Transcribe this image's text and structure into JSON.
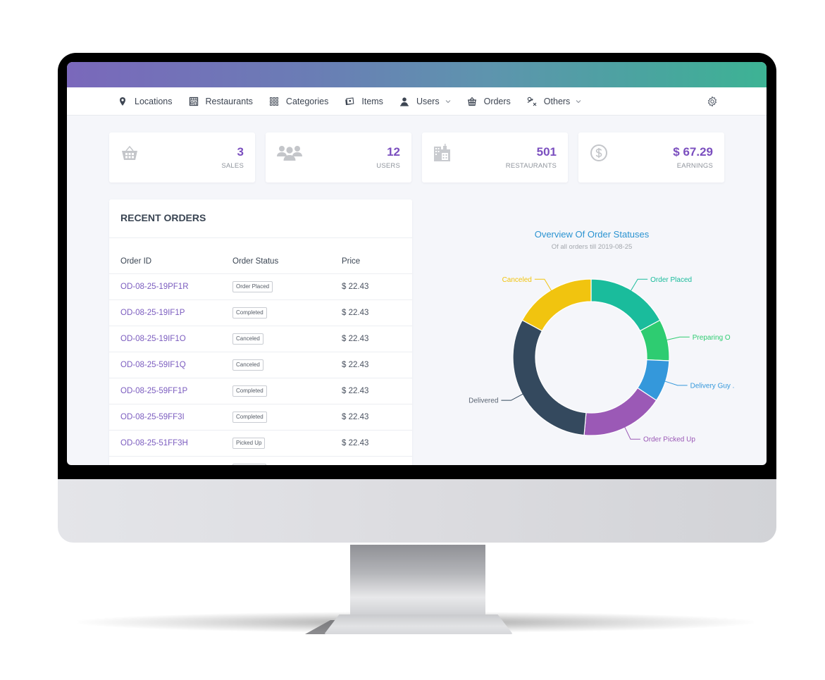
{
  "nav": {
    "items": [
      {
        "label": "Locations",
        "icon": "map-pin-icon",
        "dropdown": false
      },
      {
        "label": "Restaurants",
        "icon": "store-icon",
        "dropdown": false
      },
      {
        "label": "Categories",
        "icon": "grid-icon",
        "dropdown": false
      },
      {
        "label": "Items",
        "icon": "image-card-icon",
        "dropdown": false
      },
      {
        "label": "Users",
        "icon": "user-icon",
        "dropdown": true
      },
      {
        "label": "Orders",
        "icon": "basket-icon",
        "dropdown": false
      },
      {
        "label": "Others",
        "icon": "misc-icon",
        "dropdown": true
      }
    ],
    "settings_icon": "gear-icon"
  },
  "stats": [
    {
      "value": "3",
      "label": "SALES",
      "icon": "basket-icon"
    },
    {
      "value": "12",
      "label": "USERS",
      "icon": "users-group-icon"
    },
    {
      "value": "501",
      "label": "RESTAURANTS",
      "icon": "building-icon"
    },
    {
      "value": "$ 67.29",
      "label": "EARNINGS",
      "icon": "dollar-circle-icon"
    }
  ],
  "recent_orders": {
    "title": "RECENT ORDERS",
    "columns": [
      "Order ID",
      "Order Status",
      "Price"
    ],
    "rows": [
      {
        "id": "OD-08-25-19PF1R",
        "status": "Order Placed",
        "price": "$ 22.43"
      },
      {
        "id": "OD-08-25-19IF1P",
        "status": "Completed",
        "price": "$ 22.43"
      },
      {
        "id": "OD-08-25-19IF1O",
        "status": "Canceled",
        "price": "$ 22.43"
      },
      {
        "id": "OD-08-25-59IF1Q",
        "status": "Canceled",
        "price": "$ 22.43"
      },
      {
        "id": "OD-08-25-59FF1P",
        "status": "Completed",
        "price": "$ 22.43"
      },
      {
        "id": "OD-08-25-59FF3I",
        "status": "Completed",
        "price": "$ 22.43"
      },
      {
        "id": "OD-08-25-51FF3H",
        "status": "Picked Up",
        "price": "$ 22.43"
      },
      {
        "id": "",
        "status": "",
        "price": ""
      }
    ]
  },
  "chart_data": {
    "type": "pie",
    "variant": "donut",
    "title": "Overview Of Order Statuses",
    "subtitle": "Of all orders till 2019-08-25",
    "legend": "none (leader-line labels)",
    "slices": [
      {
        "label": "Order Placed",
        "display_label": "Order Placed",
        "value": 6,
        "color": "#1abc9c"
      },
      {
        "label": "Preparing Order",
        "display_label": "Preparing O",
        "value": 3,
        "color": "#2ecc71"
      },
      {
        "label": "Delivery Guy Assigned",
        "display_label": "Delivery Guy .",
        "value": 3,
        "color": "#3498db"
      },
      {
        "label": "Order Picked Up",
        "display_label": "Order Picked Up",
        "value": 6,
        "color": "#9b59b6"
      },
      {
        "label": "Delivered",
        "display_label": "Delivered",
        "value": 11,
        "color": "#34495e"
      },
      {
        "label": "Canceled",
        "display_label": "Canceled",
        "value": 6,
        "color": "#f1c40f"
      }
    ]
  },
  "colors": {
    "accent_purple": "#7b4fbf",
    "link_purple": "#7b5cbf",
    "chart_title_blue": "#2b93d1",
    "banner_start": "#7a68bb",
    "banner_end": "#3db394"
  }
}
